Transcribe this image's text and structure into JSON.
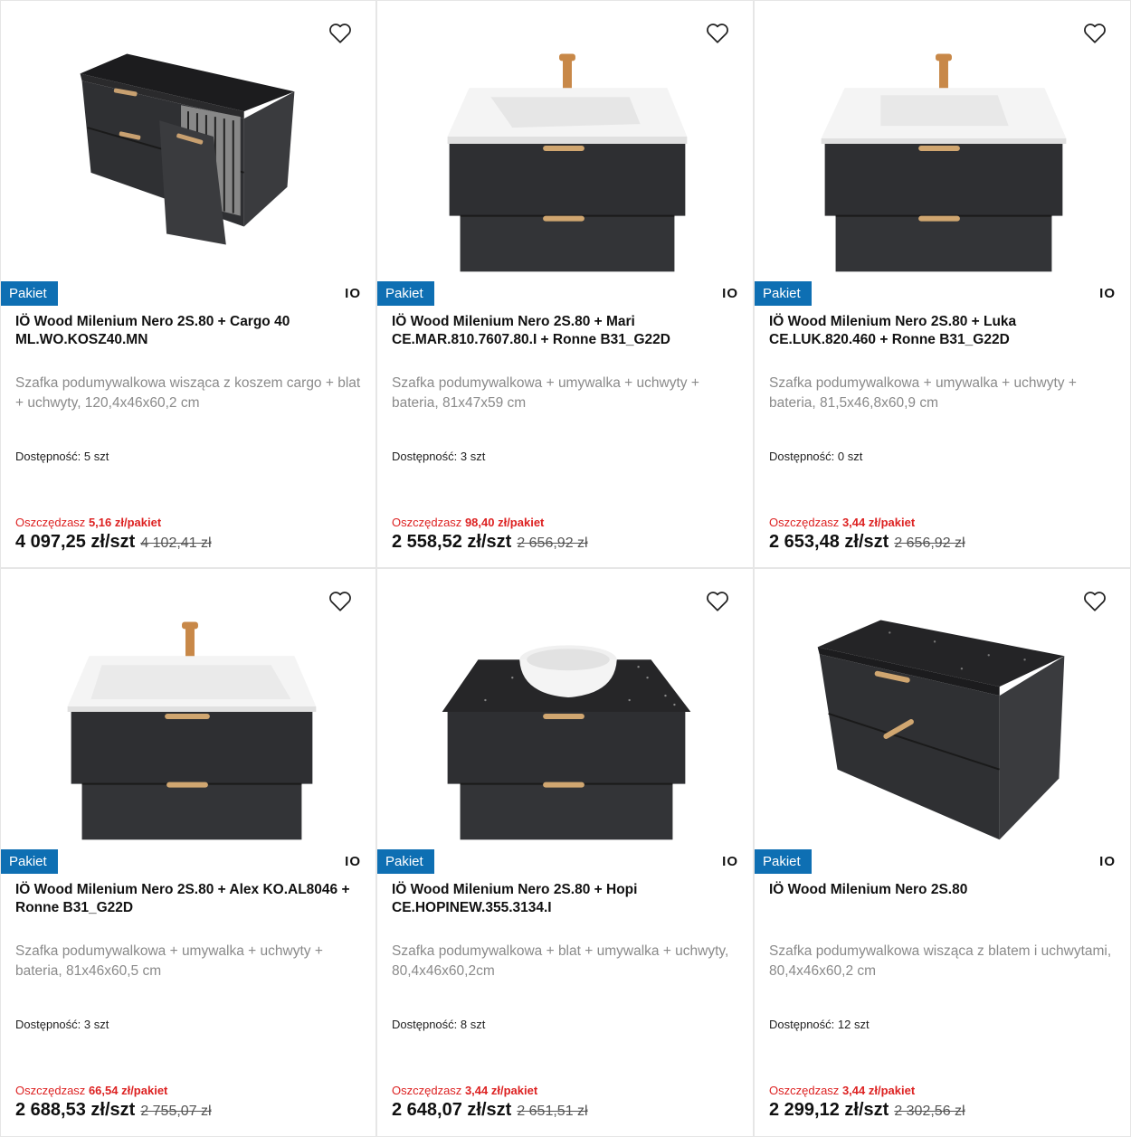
{
  "badge_label": "Pakiet",
  "brand_logo": "IO",
  "availability_label": "Dostępność:",
  "save_label": "Oszczędzasz",
  "colors": {
    "badge": "#0e6fb3",
    "save": "#dd2222"
  },
  "products": [
    {
      "title": "IÖ Wood Milenium Nero 2S.80 + Cargo 40 ML.WO.KOSZ40.MN",
      "description": "Szafka podumywalkowa wisząca z koszem cargo + blat + uchwyty, 120,4x46x60,2 cm",
      "availability": "5 szt",
      "savings": "5,16 zł/pakiet",
      "price": "4 097,25 zł/szt",
      "old_price": "4 102,41 zł",
      "image": "cabinet-cargo"
    },
    {
      "title": "IÖ Wood Milenium Nero 2S.80 + Mari CE.MAR.810.7607.80.I + Ronne B31_G22D",
      "description": "Szafka podumywalkowa + umywalka + uchwyty + bateria, 81x47x59 cm",
      "availability": "3 szt",
      "savings": "98,40 zł/pakiet",
      "price": "2 558,52 zł/szt",
      "old_price": "2 656,92 zł",
      "image": "cabinet-sink"
    },
    {
      "title": "IÖ Wood Milenium Nero 2S.80 + Luka CE.LUK.820.460 + Ronne B31_G22D",
      "description": "Szafka podumywalkowa + umywalka + uchwyty + bateria, 81,5x46,8x60,9 cm",
      "availability": "0 szt",
      "savings": "3,44 zł/pakiet",
      "price": "2 653,48 zł/szt",
      "old_price": "2 656,92 zł",
      "image": "cabinet-sink"
    },
    {
      "title": "IÖ Wood Milenium Nero 2S.80 + Alex KO.AL8046 + Ronne B31_G22D",
      "description": "Szafka podumywalkowa + umywalka + uchwyty + bateria, 81x46x60,5 cm",
      "availability": "3 szt",
      "savings": "66,54 zł/pakiet",
      "price": "2 688,53 zł/szt",
      "old_price": "2 755,07 zł",
      "image": "cabinet-sink"
    },
    {
      "title": "IÖ Wood Milenium Nero 2S.80 + Hopi CE.HOPINEW.355.3134.I",
      "description": "Szafka podumywalkowa + blat + umywalka + uchwyty, 80,4x46x60,2cm",
      "availability": "8 szt",
      "savings": "3,44 zł/pakiet",
      "price": "2 648,07 zł/szt",
      "old_price": "2 651,51 zł",
      "image": "cabinet-bowl"
    },
    {
      "title": "IÖ Wood Milenium Nero 2S.80",
      "description": "Szafka podumywalkowa wisząca z blatem i uchwytami, 80,4x46x60,2 cm",
      "availability": "12 szt",
      "savings": "3,44 zł/pakiet",
      "price": "2 299,12 zł/szt",
      "old_price": "2 302,56 zł",
      "image": "cabinet-top"
    }
  ]
}
